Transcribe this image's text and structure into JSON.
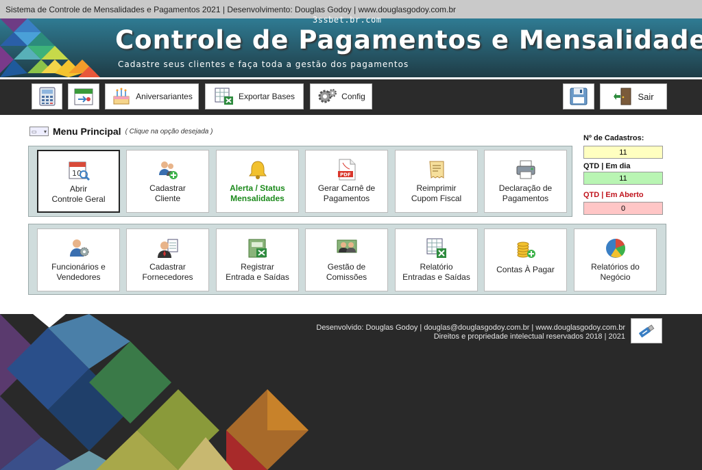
{
  "window": {
    "title": "Sistema de Controle de Mensalidades e Pagamentos 2021 | Desenvolvimento: Douglas Godoy | www.douglasgodoy.com.br",
    "watermark": "3ssbet.br.com"
  },
  "banner": {
    "title": "Controle de Pagamentos e Mensalidades",
    "subtitle": "Cadastre seus clientes e faça toda a gestão dos pagamentos"
  },
  "toolbar": {
    "calculator_icon": "calculator-icon",
    "calendar_icon": "calendar-export-icon",
    "birthdays_label": "Aniversariantes",
    "export_label": "Exportar Bases",
    "config_label": "Config",
    "save_icon": "floppy-disk-icon",
    "exit_label": "Sair"
  },
  "menu": {
    "title": "Menu Principal",
    "hint": "( Clique na opção desejada )",
    "row1": [
      {
        "label": "Abrir\nControle Geral",
        "icon": "calendar-search-icon"
      },
      {
        "label": "Cadastrar\nCliente",
        "icon": "users-add-icon"
      },
      {
        "label": "Alerta / Status\nMensalidades",
        "icon": "bell-icon"
      },
      {
        "label": "Gerar Carnê de\nPagamentos",
        "icon": "pdf-icon"
      },
      {
        "label": "Reimprimir\nCupom Fiscal",
        "icon": "receipt-icon"
      },
      {
        "label": "Declaração de\nPagamentos",
        "icon": "printer-icon"
      }
    ],
    "row2": [
      {
        "label": "Funcionários e\nVendedores",
        "icon": "staff-icon"
      },
      {
        "label": "Cadastrar\nFornecedores",
        "icon": "supplier-icon"
      },
      {
        "label": "Registrar\nEntrada e Saídas",
        "icon": "cash-register-icon"
      },
      {
        "label": "Gestão de\nComissões",
        "icon": "commission-icon"
      },
      {
        "label": "Relatório\nEntradas e Saídas",
        "icon": "spreadsheet-icon"
      },
      {
        "label": "Contas À Pagar",
        "icon": "coins-icon"
      },
      {
        "label": "Relatórios do\nNegócio",
        "icon": "pie-chart-icon"
      }
    ]
  },
  "stats": {
    "total_label": "Nº de Cadastros:",
    "total_value": "11",
    "ok_label": "QTD | Em dia",
    "ok_value": "11",
    "open_label": "QTD | Em Aberto",
    "open_value": "0",
    "colors": {
      "total": "#ffffc0",
      "ok": "#b9f5b3",
      "open": "#ffc6c6",
      "open_label": "#c0141d"
    }
  },
  "footer": {
    "line1": "Desenvolvido: Douglas Godoy | douglas@douglasgodoy.com.br | www.douglasgodoy.com.br",
    "line2": "Direitos e propriedade intelectual reservados 2018 | 2021",
    "usb_icon": "usb-icon"
  }
}
